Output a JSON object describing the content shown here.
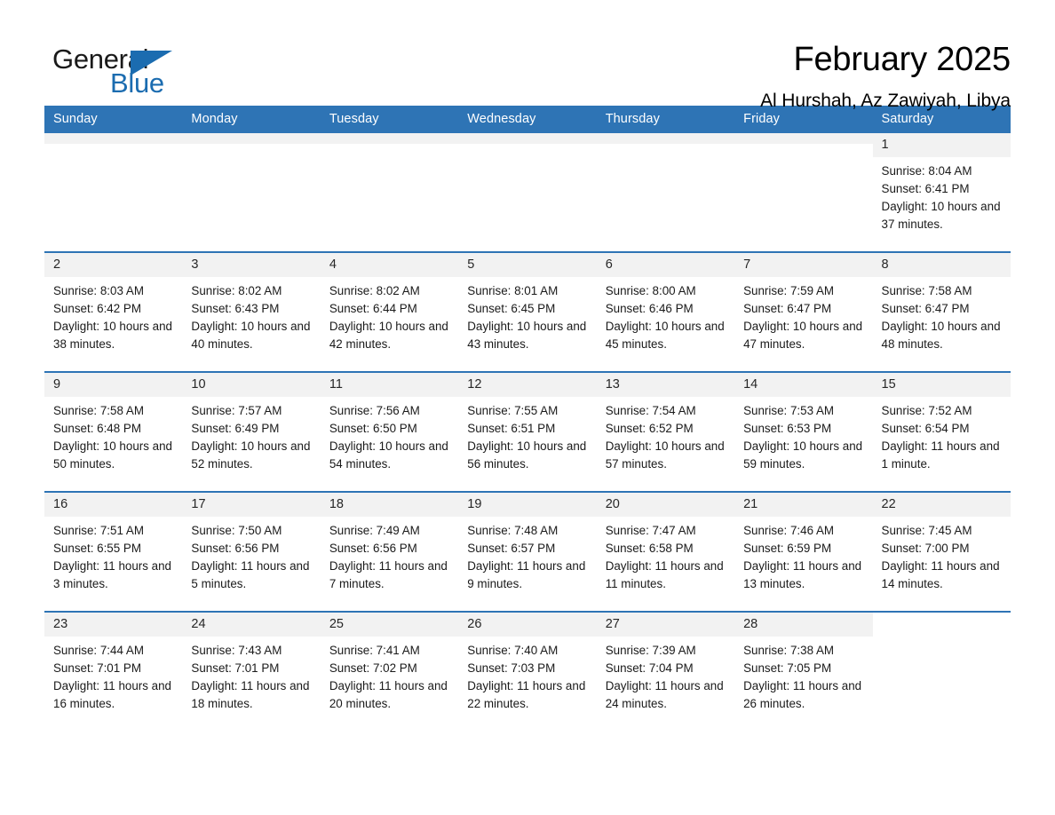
{
  "logo": {
    "word_one": "General",
    "word_two": "Blue",
    "triangle_color": "#1b6cb0"
  },
  "header": {
    "title": "February 2025",
    "subtitle": "Al Hurshah, Az Zawiyah, Libya",
    "header_bg": "#2e74b5",
    "daycell_bg": "#f2f2f2"
  },
  "calendar": {
    "weekday_headers": [
      "Sunday",
      "Monday",
      "Tuesday",
      "Wednesday",
      "Thursday",
      "Friday",
      "Saturday"
    ],
    "weeks": [
      [
        {
          "day": "",
          "empty": true
        },
        {
          "day": "",
          "empty": true
        },
        {
          "day": "",
          "empty": true
        },
        {
          "day": "",
          "empty": true
        },
        {
          "day": "",
          "empty": true
        },
        {
          "day": "",
          "empty": true
        },
        {
          "day": "1",
          "sunrise": "Sunrise: 8:04 AM",
          "sunset": "Sunset: 6:41 PM",
          "daylight": "Daylight: 10 hours and 37 minutes."
        }
      ],
      [
        {
          "day": "2",
          "sunrise": "Sunrise: 8:03 AM",
          "sunset": "Sunset: 6:42 PM",
          "daylight": "Daylight: 10 hours and 38 minutes."
        },
        {
          "day": "3",
          "sunrise": "Sunrise: 8:02 AM",
          "sunset": "Sunset: 6:43 PM",
          "daylight": "Daylight: 10 hours and 40 minutes."
        },
        {
          "day": "4",
          "sunrise": "Sunrise: 8:02 AM",
          "sunset": "Sunset: 6:44 PM",
          "daylight": "Daylight: 10 hours and 42 minutes."
        },
        {
          "day": "5",
          "sunrise": "Sunrise: 8:01 AM",
          "sunset": "Sunset: 6:45 PM",
          "daylight": "Daylight: 10 hours and 43 minutes."
        },
        {
          "day": "6",
          "sunrise": "Sunrise: 8:00 AM",
          "sunset": "Sunset: 6:46 PM",
          "daylight": "Daylight: 10 hours and 45 minutes."
        },
        {
          "day": "7",
          "sunrise": "Sunrise: 7:59 AM",
          "sunset": "Sunset: 6:47 PM",
          "daylight": "Daylight: 10 hours and 47 minutes."
        },
        {
          "day": "8",
          "sunrise": "Sunrise: 7:58 AM",
          "sunset": "Sunset: 6:47 PM",
          "daylight": "Daylight: 10 hours and 48 minutes."
        }
      ],
      [
        {
          "day": "9",
          "sunrise": "Sunrise: 7:58 AM",
          "sunset": "Sunset: 6:48 PM",
          "daylight": "Daylight: 10 hours and 50 minutes."
        },
        {
          "day": "10",
          "sunrise": "Sunrise: 7:57 AM",
          "sunset": "Sunset: 6:49 PM",
          "daylight": "Daylight: 10 hours and 52 minutes."
        },
        {
          "day": "11",
          "sunrise": "Sunrise: 7:56 AM",
          "sunset": "Sunset: 6:50 PM",
          "daylight": "Daylight: 10 hours and 54 minutes."
        },
        {
          "day": "12",
          "sunrise": "Sunrise: 7:55 AM",
          "sunset": "Sunset: 6:51 PM",
          "daylight": "Daylight: 10 hours and 56 minutes."
        },
        {
          "day": "13",
          "sunrise": "Sunrise: 7:54 AM",
          "sunset": "Sunset: 6:52 PM",
          "daylight": "Daylight: 10 hours and 57 minutes."
        },
        {
          "day": "14",
          "sunrise": "Sunrise: 7:53 AM",
          "sunset": "Sunset: 6:53 PM",
          "daylight": "Daylight: 10 hours and 59 minutes."
        },
        {
          "day": "15",
          "sunrise": "Sunrise: 7:52 AM",
          "sunset": "Sunset: 6:54 PM",
          "daylight": "Daylight: 11 hours and 1 minute."
        }
      ],
      [
        {
          "day": "16",
          "sunrise": "Sunrise: 7:51 AM",
          "sunset": "Sunset: 6:55 PM",
          "daylight": "Daylight: 11 hours and 3 minutes."
        },
        {
          "day": "17",
          "sunrise": "Sunrise: 7:50 AM",
          "sunset": "Sunset: 6:56 PM",
          "daylight": "Daylight: 11 hours and 5 minutes."
        },
        {
          "day": "18",
          "sunrise": "Sunrise: 7:49 AM",
          "sunset": "Sunset: 6:56 PM",
          "daylight": "Daylight: 11 hours and 7 minutes."
        },
        {
          "day": "19",
          "sunrise": "Sunrise: 7:48 AM",
          "sunset": "Sunset: 6:57 PM",
          "daylight": "Daylight: 11 hours and 9 minutes."
        },
        {
          "day": "20",
          "sunrise": "Sunrise: 7:47 AM",
          "sunset": "Sunset: 6:58 PM",
          "daylight": "Daylight: 11 hours and 11 minutes."
        },
        {
          "day": "21",
          "sunrise": "Sunrise: 7:46 AM",
          "sunset": "Sunset: 6:59 PM",
          "daylight": "Daylight: 11 hours and 13 minutes."
        },
        {
          "day": "22",
          "sunrise": "Sunrise: 7:45 AM",
          "sunset": "Sunset: 7:00 PM",
          "daylight": "Daylight: 11 hours and 14 minutes."
        }
      ],
      [
        {
          "day": "23",
          "sunrise": "Sunrise: 7:44 AM",
          "sunset": "Sunset: 7:01 PM",
          "daylight": "Daylight: 11 hours and 16 minutes."
        },
        {
          "day": "24",
          "sunrise": "Sunrise: 7:43 AM",
          "sunset": "Sunset: 7:01 PM",
          "daylight": "Daylight: 11 hours and 18 minutes."
        },
        {
          "day": "25",
          "sunrise": "Sunrise: 7:41 AM",
          "sunset": "Sunset: 7:02 PM",
          "daylight": "Daylight: 11 hours and 20 minutes."
        },
        {
          "day": "26",
          "sunrise": "Sunrise: 7:40 AM",
          "sunset": "Sunset: 7:03 PM",
          "daylight": "Daylight: 11 hours and 22 minutes."
        },
        {
          "day": "27",
          "sunrise": "Sunrise: 7:39 AM",
          "sunset": "Sunset: 7:04 PM",
          "daylight": "Daylight: 11 hours and 24 minutes."
        },
        {
          "day": "28",
          "sunrise": "Sunrise: 7:38 AM",
          "sunset": "Sunset: 7:05 PM",
          "daylight": "Daylight: 11 hours and 26 minutes."
        },
        {
          "day": "",
          "empty": true,
          "blank": true
        }
      ]
    ]
  }
}
